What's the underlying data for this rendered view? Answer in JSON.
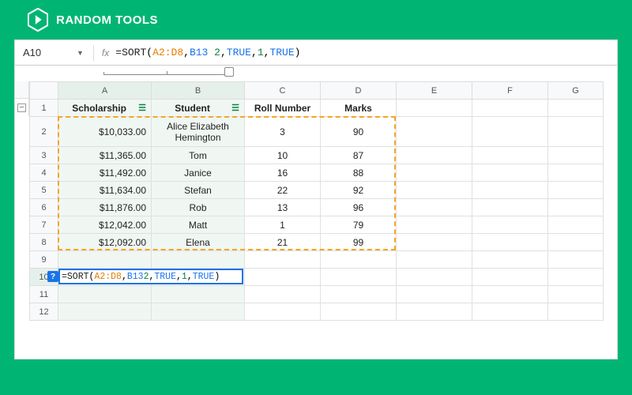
{
  "brand": "RANDOM TOOLS",
  "nameBox": "A10",
  "fx": "fx",
  "formula": {
    "eq": "=",
    "fn": "SORT",
    "open": "(",
    "range": "A2:D8",
    "c1": ",",
    "ref": "B13",
    "sp": " ",
    "n2": "2",
    "c2": ",",
    "b1": "TRUE",
    "c3": ",",
    "n1": "1",
    "c4": ",",
    "b2": "TRUE",
    "close": ")"
  },
  "cols": [
    "A",
    "B",
    "C",
    "D",
    "E",
    "F",
    "G"
  ],
  "rows": [
    "1",
    "2",
    "3",
    "4",
    "5",
    "6",
    "7",
    "8",
    "9",
    "10",
    "11",
    "12"
  ],
  "headers": {
    "A": "Scholarship",
    "B": "Student",
    "C": "Roll Number",
    "D": "Marks"
  },
  "data": [
    {
      "scholarship": "$10,033.00",
      "student": "Alice Elizabeth Hemington",
      "roll": "3",
      "marks": "90"
    },
    {
      "scholarship": "$11,365.00",
      "student": "Tom",
      "roll": "10",
      "marks": "87"
    },
    {
      "scholarship": "$11,492.00",
      "student": "Janice",
      "roll": "16",
      "marks": "88"
    },
    {
      "scholarship": "$11,634.00",
      "student": "Stefan",
      "roll": "22",
      "marks": "92"
    },
    {
      "scholarship": "$11,876.00",
      "student": "Rob",
      "roll": "13",
      "marks": "96"
    },
    {
      "scholarship": "$12,042.00",
      "student": "Matt",
      "roll": "1",
      "marks": "79"
    },
    {
      "scholarship": "$12,092.00",
      "student": "Elena",
      "roll": "21",
      "marks": "99"
    }
  ],
  "hintQ": "?",
  "collapse": "−"
}
